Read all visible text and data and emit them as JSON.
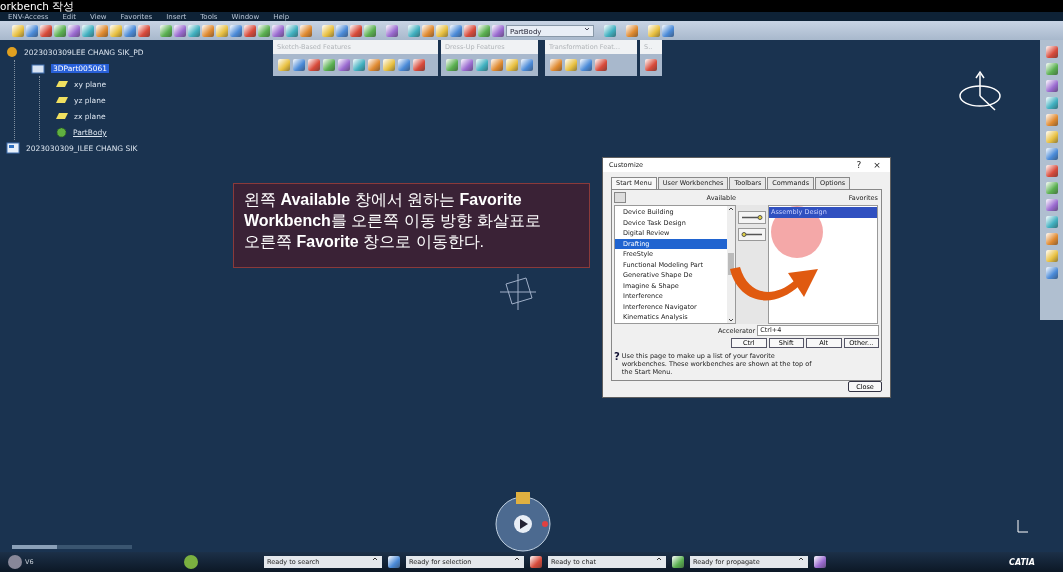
{
  "window": {
    "title": "orkbench 작성"
  },
  "menu": [
    "ENV-Access",
    "Edit",
    "View",
    "Favorites",
    "Insert",
    "Tools",
    "Window",
    "Help"
  ],
  "toolbar": {
    "dropdown": "PartBody"
  },
  "tree": [
    {
      "label": "2023030309LEE CHANG SIK_PD",
      "kind": "product",
      "selected": false,
      "children": [
        {
          "label": "3DPart005061",
          "kind": "part",
          "selected": true,
          "children": [
            {
              "label": "xy plane",
              "kind": "plane",
              "selected": false
            },
            {
              "label": "yz plane",
              "kind": "plane",
              "selected": false
            },
            {
              "label": "zx plane",
              "kind": "plane",
              "selected": false
            },
            {
              "label": "PartBody",
              "kind": "body",
              "selected": false
            }
          ]
        }
      ]
    },
    {
      "label": "2023030309_ILEE CHANG SIK",
      "kind": "document",
      "selected": false
    }
  ],
  "floating_toolbars": [
    {
      "title": "Sketch-Based Features"
    },
    {
      "title": "Dress-Up Features"
    },
    {
      "title": "Transformation Feat..."
    },
    {
      "title": "S.."
    }
  ],
  "annotation": {
    "text": "왼쪽 **Available** 창에서 원하는 **Favorite Workbench**를 오른쪽 이동 방향 화살표로 오른쪽 **Favorite** 창으로 이동한다."
  },
  "dialog": {
    "title": "Customize",
    "help_mark": "?",
    "close_mark": "×",
    "tabs": [
      {
        "label": "Start Menu",
        "selected": true
      },
      {
        "label": "User Workbenches",
        "selected": false
      },
      {
        "label": "Toolbars",
        "selected": false
      },
      {
        "label": "Commands",
        "selected": false
      },
      {
        "label": "Options",
        "selected": false
      }
    ],
    "available_label": "Available",
    "favorites_label": "Favorites",
    "available": [
      {
        "label": "Device Building",
        "selected": false
      },
      {
        "label": "Device Task Design",
        "selected": false
      },
      {
        "label": "Digital Review",
        "selected": false
      },
      {
        "label": "Drafting",
        "selected": true
      },
      {
        "label": "FreeStyle",
        "selected": false
      },
      {
        "label": "Functional Modeling Part",
        "selected": false
      },
      {
        "label": "Generative Shape De",
        "selected": false
      },
      {
        "label": "Imagine & Shape",
        "selected": false
      },
      {
        "label": "Interference",
        "selected": false
      },
      {
        "label": "Interference Navigator",
        "selected": false
      },
      {
        "label": "Kinematics Analysis",
        "selected": false
      }
    ],
    "favorites": [
      {
        "label": "Assembly Design",
        "selected": true
      }
    ],
    "accelerator_label": "Accelerator",
    "accelerator": "Ctrl+4",
    "modifier_buttons": [
      "Ctrl",
      "Shift",
      "Alt",
      "Other..."
    ],
    "help_icon": "?",
    "help_text": "Use this page to make up a list of your favorite workbenches. These workbenches are shown at the top of the Start Menu.",
    "close_button": "Close"
  },
  "status_bar": {
    "user": "V6",
    "fields": [
      "Ready to search",
      "Ready for selection",
      "Ready to chat",
      "Ready for propagate"
    ],
    "logo": "CATIA"
  }
}
